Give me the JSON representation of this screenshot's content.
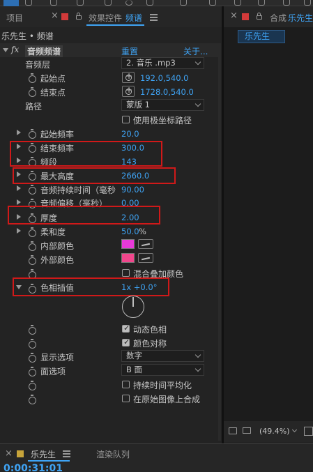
{
  "left_tabs": {
    "project": "项目",
    "effect_controls": "效果控件",
    "effect_target": "频谱"
  },
  "right_tab": {
    "prefix": "合成",
    "name": "乐先生"
  },
  "right_breadcrumb": "乐先生",
  "header_path": "乐先生 • 频谱",
  "effect": {
    "fx_label": "fx",
    "name": "音频频谱",
    "reset": "重置",
    "about": "关于..."
  },
  "rows": {
    "audio_layer": {
      "label": "音频层",
      "value": "2. 音乐 .mp3"
    },
    "start_point": {
      "label": "起始点",
      "value": "192.0,540.0"
    },
    "end_point": {
      "label": "结束点",
      "value": "1728.0,540.0"
    },
    "path": {
      "label": "路径",
      "value": "蒙版 1"
    },
    "polar": {
      "label": "使用极坐标路径"
    },
    "start_freq": {
      "label": "起始频率",
      "value": "20.0"
    },
    "end_freq": {
      "label": "结束频率",
      "value": "300.0"
    },
    "bands": {
      "label": "频段",
      "value": "143"
    },
    "max_height": {
      "label": "最大高度",
      "value": "2660.0"
    },
    "audio_duration": {
      "label": "音频持续时间（毫秒",
      "value": "90.00"
    },
    "audio_offset": {
      "label": "音频偏移（毫秒）",
      "value": "0.00"
    },
    "thickness": {
      "label": "厚度",
      "value": "2.00"
    },
    "softness": {
      "label": "柔和度",
      "value": "50.0",
      "unit": "%"
    },
    "inside_color": {
      "label": "内部颜色",
      "color": "#e83ad8"
    },
    "outside_color": {
      "label": "外部颜色",
      "color": "#f0468c"
    },
    "blend_overlap": {
      "label": "混合叠加颜色"
    },
    "hue_interp": {
      "label": "色相插值",
      "value": "1x +0.0°"
    },
    "dynamic_hue": {
      "label": "动态色相"
    },
    "color_symmetry": {
      "label": "颜色对称"
    },
    "display_options": {
      "label": "显示选项",
      "value": "数字"
    },
    "side_options": {
      "label": "面选项",
      "value": "B 面"
    },
    "avg_time": {
      "label": "持续时间平均化"
    },
    "composite_on_original": {
      "label": "在原始图像上合成"
    }
  },
  "viewer_zoom": "(49.4%)",
  "bottom": {
    "comp_tab": "乐先生",
    "render_queue": "渲染队列",
    "timecode": "0:00:31:01"
  },
  "colors": {
    "accent": "#3fa4f5",
    "highlight_box": "#d01919",
    "bg": "#232323"
  }
}
